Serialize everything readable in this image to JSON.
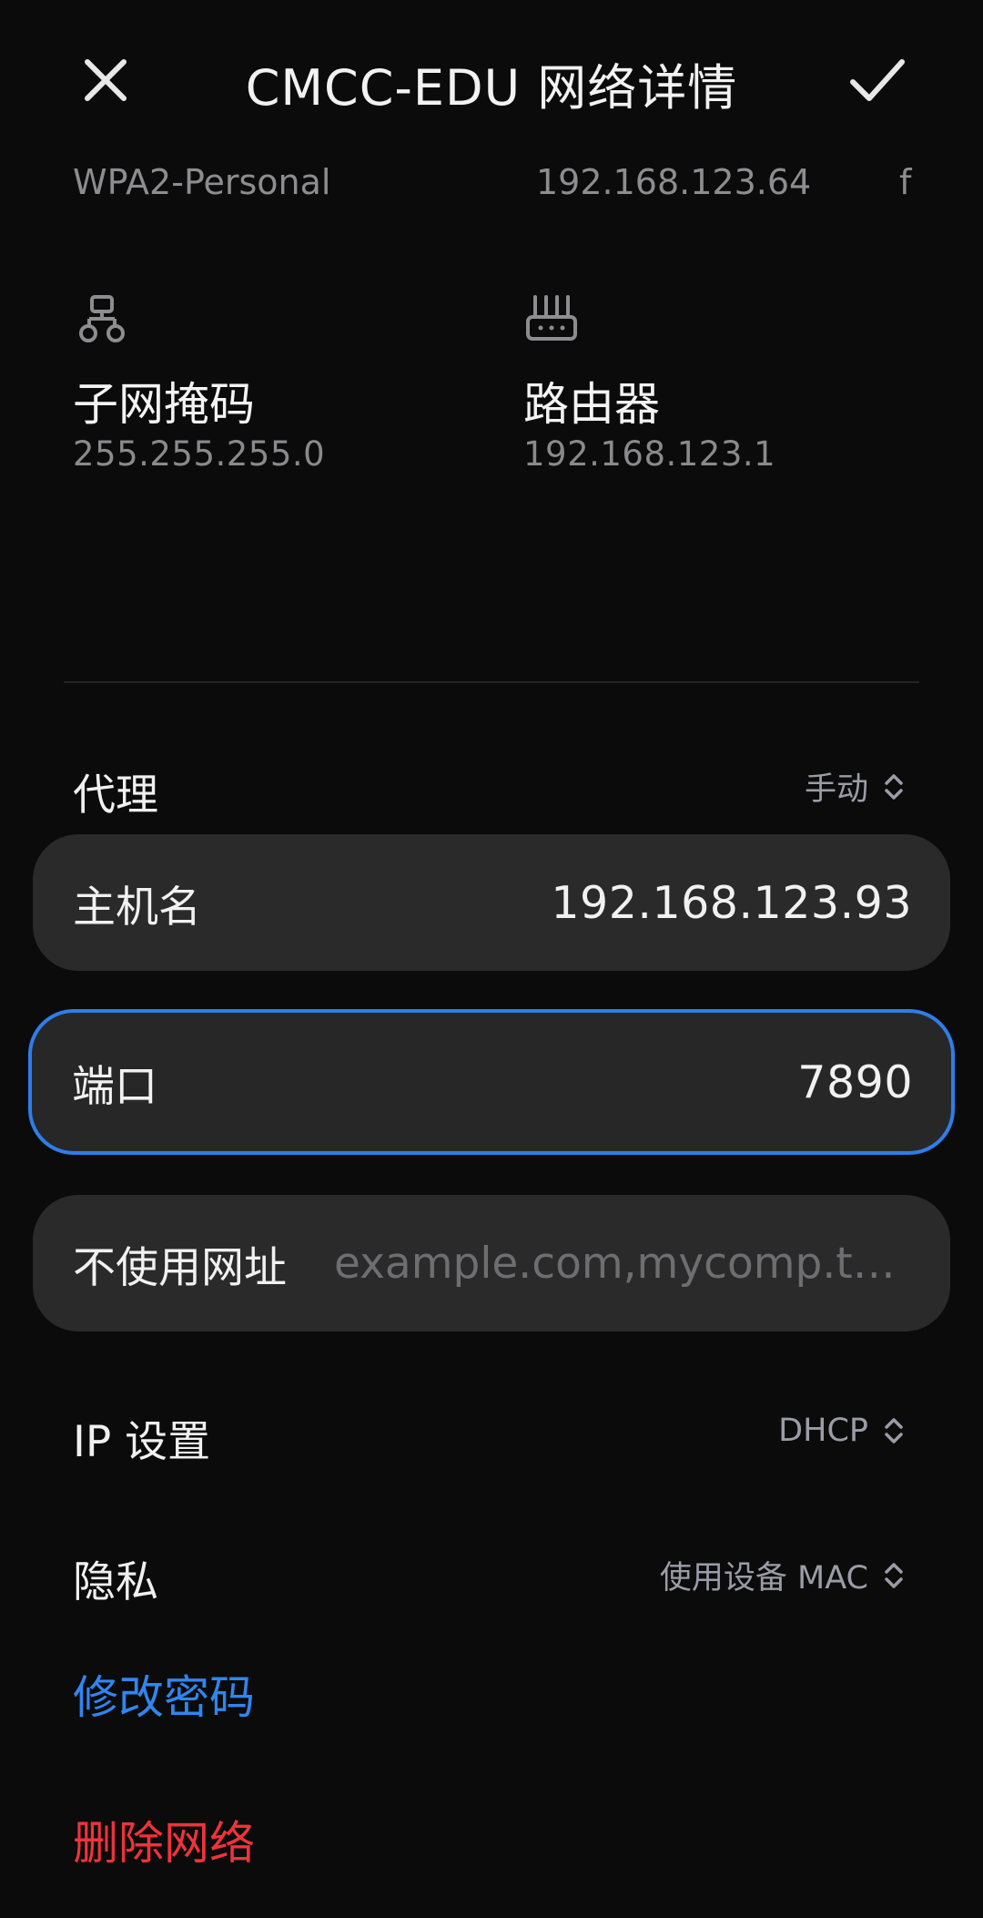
{
  "header": {
    "title": "CMCC-EDU 网络详情"
  },
  "info_row": {
    "security": "WPA2-Personal",
    "ip_address": "192.168.123.64",
    "partial": "f"
  },
  "details": {
    "subnet": {
      "label": "子网掩码",
      "value": "255.255.255.0",
      "icon": "network-topology-icon"
    },
    "router": {
      "label": "路由器",
      "value": "192.168.123.1",
      "icon": "router-icon"
    }
  },
  "proxy": {
    "label": "代理",
    "mode": "手动",
    "hostname": {
      "label": "主机名",
      "value": "192.168.123.93"
    },
    "port": {
      "label": "端口",
      "value": "7890"
    },
    "bypass": {
      "label": "不使用网址",
      "placeholder": "example.com,mycomp.t…"
    }
  },
  "ip_settings": {
    "label": "IP 设置",
    "value": "DHCP"
  },
  "privacy": {
    "label": "隐私",
    "value": "使用设备 MAC"
  },
  "actions": {
    "change_password": "修改密码",
    "delete_network": "删除网络"
  },
  "colors": {
    "background": "#0b0b0b",
    "card": "#2a2a2b",
    "focus_border": "#2d7ee8",
    "link_blue": "#2f86f0",
    "link_red": "#f0323a"
  }
}
